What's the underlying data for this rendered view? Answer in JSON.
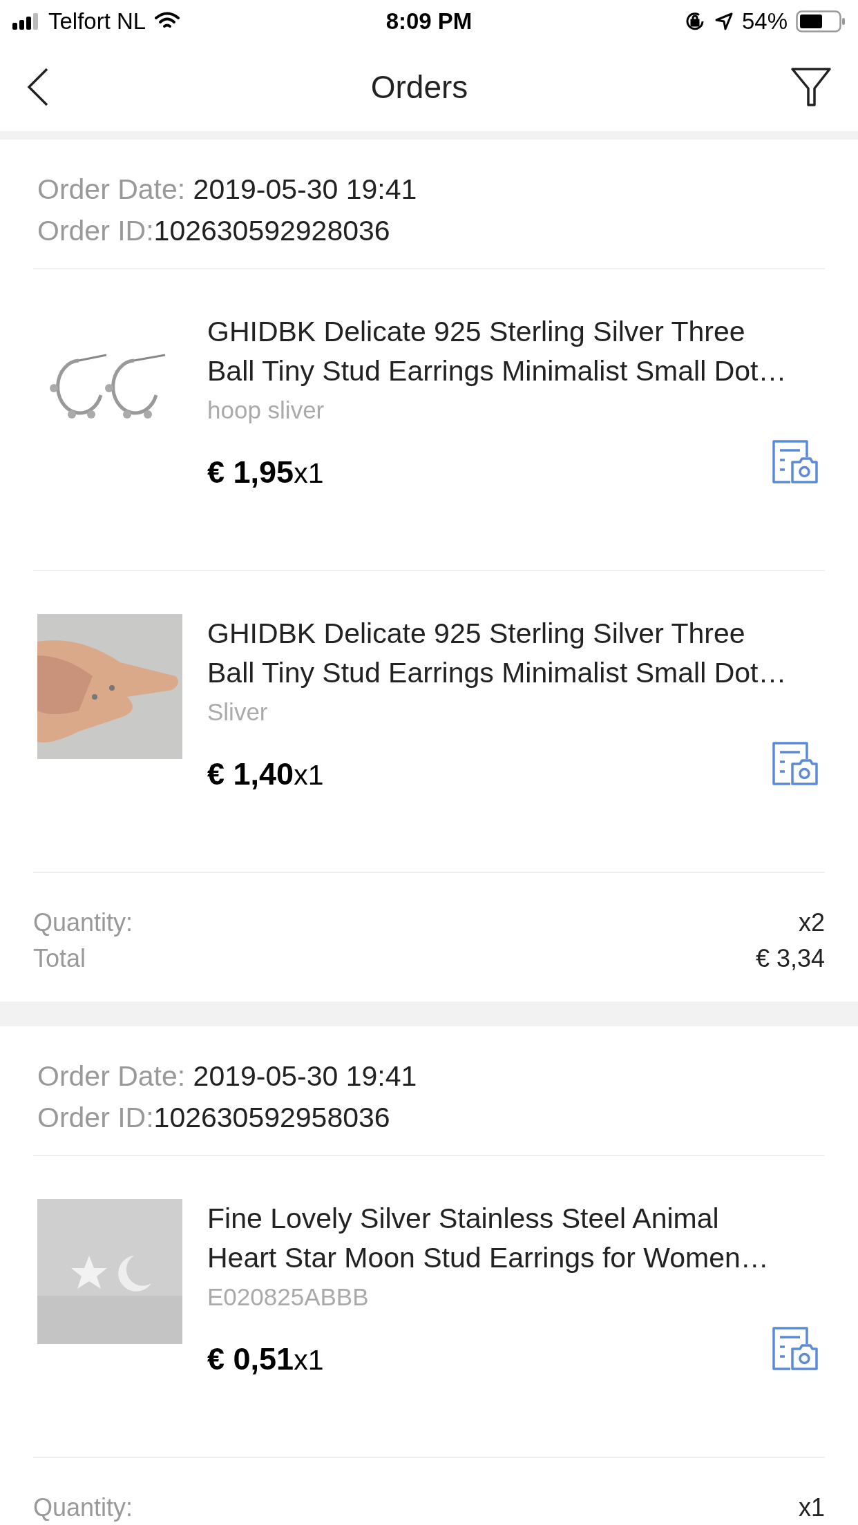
{
  "status_bar": {
    "carrier": "Telfort NL",
    "time": "8:09 PM",
    "battery": "54%"
  },
  "nav": {
    "title": "Orders"
  },
  "orders": [
    {
      "date_label": "Order Date:",
      "date": "2019-05-30 19:41",
      "id_label": "Order ID:",
      "id": "102630592928036",
      "items": [
        {
          "kind": "picture",
          "title": "GHIDBK Delicate 925 Sterling Silver Three Ball Tiny Stud Earrings Minimalist Small Dot…",
          "variant": "hoop sliver",
          "price": "€ 1,95",
          "qty": "x1"
        },
        {
          "kind": "picture",
          "title": "GHIDBK Delicate 925 Sterling Silver Three Ball Tiny Stud Earrings Minimalist Small Dot…",
          "variant": "Sliver",
          "price": "€ 1,40",
          "qty": "x1"
        }
      ],
      "quantity_label": "Quantity:",
      "quantity": "x2",
      "total_label": "Total",
      "total": "€ 3,34"
    },
    {
      "date_label": "Order Date:",
      "date": "2019-05-30 19:41",
      "id_label": "Order ID:",
      "id": "102630592958036",
      "items": [
        {
          "kind": "picture",
          "title": "Fine Lovely Silver Stainless Steel Animal Heart Star Moon Stud Earrings for Women…",
          "variant": "E020825ABBB",
          "price": "€ 0,51",
          "qty": "x1"
        }
      ],
      "quantity_label": "Quantity:",
      "quantity": "x1"
    }
  ]
}
